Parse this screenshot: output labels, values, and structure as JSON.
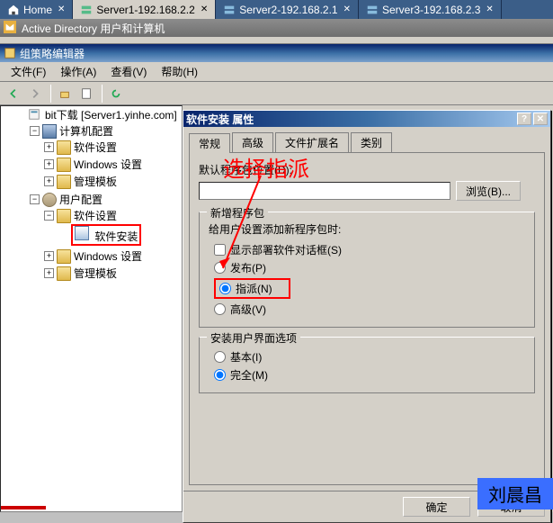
{
  "topTabs": {
    "home": "Home",
    "server1": "Server1-192.168.2.2",
    "server2": "Server2-192.168.2.1",
    "server3": "Server3-192.168.2.3"
  },
  "adTitle": "Active Directory 用户和计算机",
  "gpTitle": "组策略编辑器",
  "menu": {
    "file": "文件(F)",
    "action": "操作(A)",
    "view": "查看(V)",
    "help": "帮助(H)"
  },
  "tree": {
    "root": "bit下载 [Server1.yinhe.com]",
    "compCfg": "计算机配置",
    "swSettings": "软件设置",
    "winSettings": "Windows 设置",
    "adminTpl": "管理模板",
    "userCfg": "用户配置",
    "swInstall": "软件安装",
    "winSettings2": "Windows 设置",
    "adminTpl2": "管理模板"
  },
  "dialog": {
    "title": "软件安装 属性",
    "tabs": {
      "general": "常规",
      "advanced": "高级",
      "ext": "文件扩展名",
      "cat": "类别"
    },
    "defaultPkgLabel": "默认程序包位置(D):",
    "defaultPkgValue": "",
    "browse": "浏览(B)...",
    "newPkgGroup": "新增程序包",
    "newPkgHint": "给用户设置添加新程序包时:",
    "showDlg": "显示部署软件对话框(S)",
    "publish": "发布(P)",
    "assign": "指派(N)",
    "advancedOpt": "高级(V)",
    "uiGroup": "安装用户界面选项",
    "basic": "基本(I)",
    "full": "完全(M)",
    "ok": "确定",
    "cancel": "取消"
  },
  "annotation": "选择指派",
  "watermark": "刘晨昌"
}
